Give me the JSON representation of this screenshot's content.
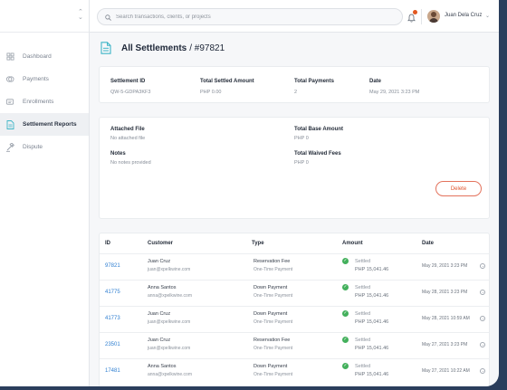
{
  "search": {
    "placeholder": "Search transactions, clients, or projects"
  },
  "user": {
    "name": "Juan Dela Cruz"
  },
  "sidebar": {
    "items": [
      {
        "label": "Dashboard",
        "icon": "dashboard-icon"
      },
      {
        "label": "Payments",
        "icon": "payments-icon"
      },
      {
        "label": "Enrollments",
        "icon": "enrollments-icon"
      },
      {
        "label": "Settlement Reports",
        "icon": "settlement-reports-icon",
        "active": true
      },
      {
        "label": "Dispute",
        "icon": "dispute-icon"
      }
    ]
  },
  "page": {
    "title": "All Settlements",
    "subtitle": "/ #97821"
  },
  "summary": {
    "settlement_id_label": "Settlement ID",
    "settlement_id": "QW-5-GDPA3KF3",
    "total_settled_label": "Total Settled Amount",
    "total_settled": "PHP 0.00",
    "total_payments_label": "Total Payments",
    "total_payments": "2",
    "date_label": "Date",
    "date": "May 29, 2021 3:23 PM"
  },
  "details": {
    "attached_file_label": "Attached File",
    "attached_file": "No attached file",
    "notes_label": "Notes",
    "notes": "No notes provided",
    "total_base_label": "Total Base Amount",
    "total_base": "PHP 0",
    "total_waived_label": "Total Waived Fees",
    "total_waived": "PHP 0",
    "delete_label": "Delete"
  },
  "table": {
    "headers": {
      "id": "ID",
      "customer": "Customer",
      "type": "Type",
      "amount": "Amount",
      "date": "Date"
    },
    "rows": [
      {
        "id": "97821",
        "name": "Juan Cruz",
        "email": "juan@xpelkwine.com",
        "type": "Reservation Fee",
        "payment": "One-Time Payment",
        "status": "Settled",
        "amount": "PHP 15,041.46",
        "date": "May 29, 2021 3:23 PM"
      },
      {
        "id": "41775",
        "name": "Anna Santos",
        "email": "anna@xpelkwine.com",
        "type": "Down Payment",
        "payment": "One-Time Payment",
        "status": "Settled",
        "amount": "PHP 15,041.46",
        "date": "May 28, 2021 3:23 PM"
      },
      {
        "id": "41773",
        "name": "Juan Cruz",
        "email": "juan@xpelkwine.com",
        "type": "Down Payment",
        "payment": "One-Time Payment",
        "status": "Settled",
        "amount": "PHP 15,041.46",
        "date": "May 28, 2021 10:59 AM"
      },
      {
        "id": "23501",
        "name": "Juan Cruz",
        "email": "juan@xpelkwine.com",
        "type": "Reservation Fee",
        "payment": "One-Time Payment",
        "status": "Settled",
        "amount": "PHP 15,041.46",
        "date": "May 27, 2021 3:23 PM"
      },
      {
        "id": "17481",
        "name": "Anna Santos",
        "email": "anna@xpelkwine.com",
        "type": "Down Payment",
        "payment": "One-Time Payment",
        "status": "Settled",
        "amount": "PHP 15,041.46",
        "date": "May 27, 2021 10:22 AM"
      }
    ]
  },
  "colors": {
    "accent": "#2f7fd1",
    "danger": "#e0552f",
    "success": "#43b05c",
    "icon_teal": "#3fb5c7",
    "frame_bg": "#2b3e5c"
  }
}
